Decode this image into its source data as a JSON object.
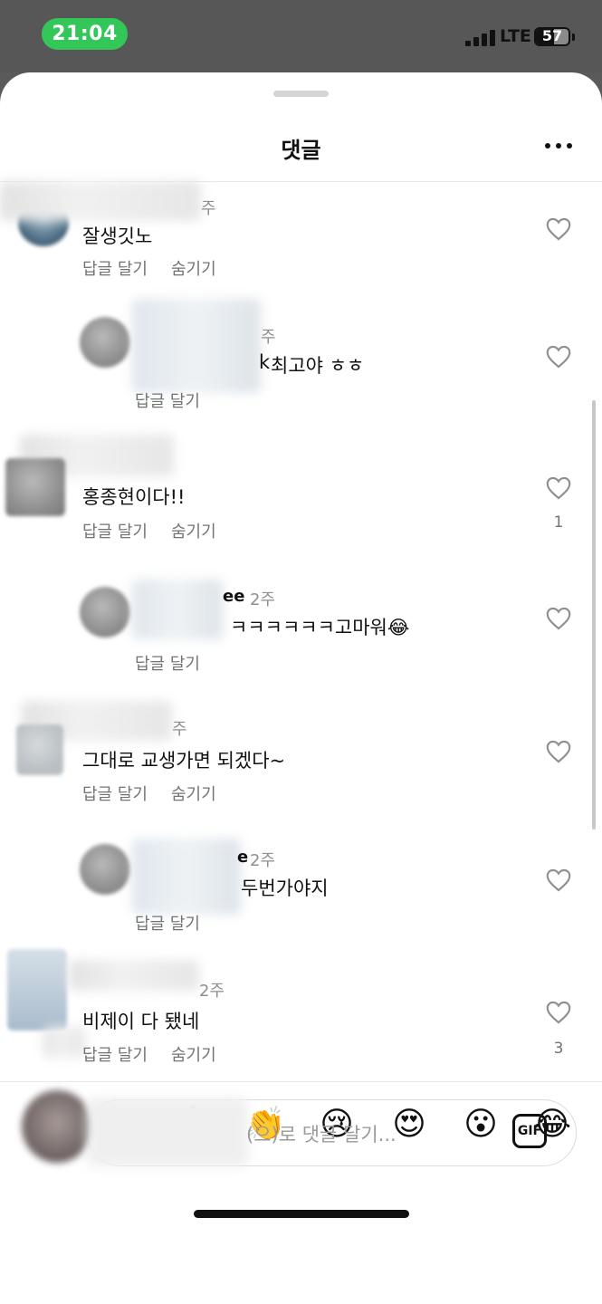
{
  "status_bar": {
    "time": "21:04",
    "network": "LTE",
    "battery": "57",
    "time_pill_color": "#33c759"
  },
  "header": {
    "title": "댓글",
    "more_icon": "more-horizontal-icon"
  },
  "comments": [
    {
      "meta_time": "주",
      "text": "잘생깃노",
      "actions": [
        "답글 달기",
        "숨기기"
      ],
      "likes": ""
    },
    {
      "meta_time": "주",
      "text": "최고야 ㅎㅎ",
      "text_prefix": "k",
      "actions": [
        "답글 달기"
      ],
      "likes": ""
    },
    {
      "meta_time": "",
      "text": "홍종현이다!!",
      "actions": [
        "답글 달기",
        "숨기기"
      ],
      "likes": "1"
    },
    {
      "meta_user_suffix": "ee",
      "meta_time": "2주",
      "text": "ㅋㅋㅋㅋㅋㅋ고마워😂",
      "actions": [
        "답글 달기"
      ],
      "likes": ""
    },
    {
      "meta_time": "주",
      "text": "그대로 교생가면 되겠다~",
      "actions": [
        "답글 달기",
        "숨기기"
      ],
      "likes": ""
    },
    {
      "meta_user_suffix": "e",
      "meta_time": "2주",
      "text": "두번가야지",
      "actions": [
        "답글 달기"
      ],
      "likes": ""
    },
    {
      "meta_time": "2주",
      "text": "비제이 다 됐네",
      "actions": [
        "답글 달기",
        "숨기기"
      ],
      "likes": "3"
    }
  ],
  "quick_reactions": [
    "❤️",
    "🙌",
    "🔥",
    "👏",
    "😢",
    "😍",
    "😮",
    "😂"
  ],
  "composer": {
    "placeholder": "(으)로 댓글 달기...",
    "gif_label": "GIF"
  }
}
